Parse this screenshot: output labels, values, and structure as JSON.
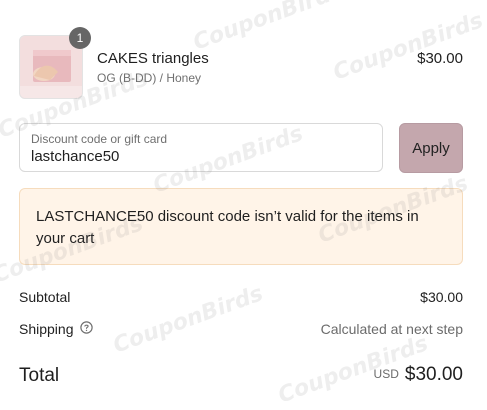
{
  "product": {
    "name": "CAKES triangles",
    "variant": "OG (B-DD) / Honey",
    "price": "$30.00",
    "quantity": "1",
    "image": "product-thumbnail"
  },
  "discount": {
    "label": "Discount code or gift card",
    "value": "lastchance50",
    "apply_label": "Apply"
  },
  "error": {
    "message": "LASTCHANCE50 discount code isn’t valid for the items in your cart"
  },
  "summary": {
    "subtotal_label": "Subtotal",
    "subtotal_value": "$30.00",
    "shipping_label": "Shipping",
    "shipping_value": "Calculated at next step",
    "total_label": "Total",
    "currency": "USD",
    "total_value": "$30.00"
  },
  "watermark": {
    "text": "CouponBirds"
  },
  "colors": {
    "apply_button": "#c4a7ad",
    "error_background": "#fff4e8",
    "error_border": "#f6dcbd",
    "badge": "#666666"
  }
}
